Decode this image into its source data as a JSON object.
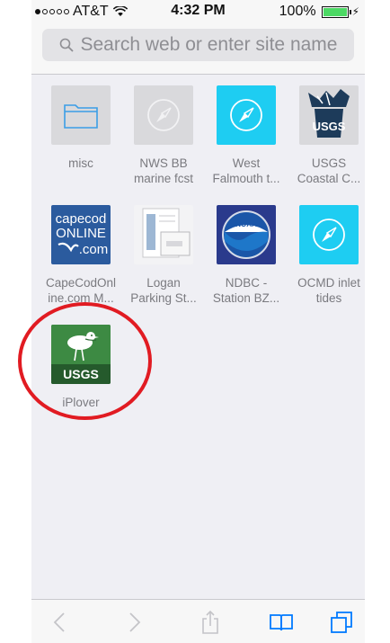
{
  "status_bar": {
    "carrier": "AT&T",
    "time": "4:32 PM",
    "battery": "100%"
  },
  "search": {
    "placeholder": "Search web or enter site name"
  },
  "bookmarks": [
    {
      "label": "misc",
      "icon": "folder-icon"
    },
    {
      "label": "NWS BB\nmarine fcst",
      "icon": "compass-icon"
    },
    {
      "label": "West\nFalmouth t...",
      "icon": "compass-icon"
    },
    {
      "label": "USGS\nCoastal C...",
      "icon": "usgs-coastal-icon",
      "logo_text": "USGS"
    },
    {
      "label": "CapeCodOnl\nine.com M...",
      "icon": "capecod-online-icon",
      "logo_text": "capecod\nONLINE\n.com"
    },
    {
      "label": "Logan\nParking St...",
      "icon": "document-thumbnail-icon"
    },
    {
      "label": "NDBC -\nStation BZ...",
      "icon": "noaa-icon",
      "logo_text": "NOAA"
    },
    {
      "label": "OCMD inlet\ntides",
      "icon": "compass-icon"
    },
    {
      "label": "iPlover",
      "icon": "iplover-usgs-icon",
      "logo_text": "USGS"
    }
  ],
  "toolbar": {
    "buttons": [
      "back-icon",
      "forward-icon",
      "share-icon",
      "bookmarks-icon",
      "tabs-icon"
    ]
  },
  "colors": {
    "accent": "#007aff",
    "annotation": "#e11b22",
    "tile_cyan": "#1ecdf2"
  }
}
